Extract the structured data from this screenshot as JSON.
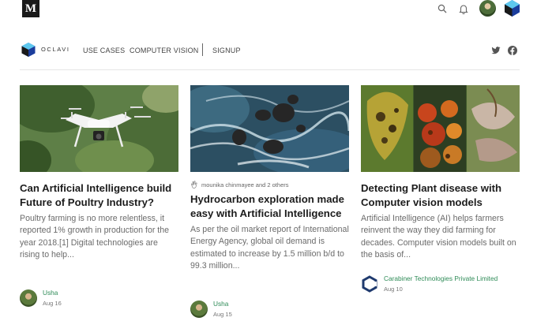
{
  "header": {
    "logo_letter": "M",
    "icons": [
      "search-icon",
      "bell-icon",
      "user-avatar",
      "cube-logo-icon"
    ]
  },
  "publication": {
    "name": "OCLAVI",
    "nav": [
      "USE CASES",
      "COMPUTER VISION",
      "SIGNUP"
    ],
    "social": [
      "twitter-icon",
      "facebook-icon"
    ]
  },
  "posts": [
    {
      "title": "Can Artificial Intelligence build Future of Poultry Industry?",
      "snippet": "Poultry farming is no more relentless, it reported 1% growth in production for the year 2018.[1] Digital technologies are rising to help...",
      "author": "Usha",
      "date": "Aug 16",
      "recommended_by": ""
    },
    {
      "title": "Hydrocarbon exploration made easy with Artificial Intelligence",
      "snippet": "As per the oil market report of International Energy Agency, global oil demand is estimated to increase by 1.5 million b/d to 99.3 million...",
      "author": "Usha",
      "date": "Aug 15",
      "recommended_by": "mounika chinmayee and 2 others"
    },
    {
      "title": "Detecting Plant disease with Computer vision models",
      "snippet": "Artificial Intelligence (AI) helps farmers reinvent the way they did farming for decades. Computer vision models built on the basis of...",
      "author": "Carabiner Technologies Private Limited",
      "date": "Aug 10",
      "recommended_by": ""
    }
  ],
  "colors": {
    "author_link": "#2e8b57",
    "text_primary": "#1c1c1c",
    "text_secondary": "#6b6b6b",
    "logo_blue": "#2a5bd7"
  }
}
